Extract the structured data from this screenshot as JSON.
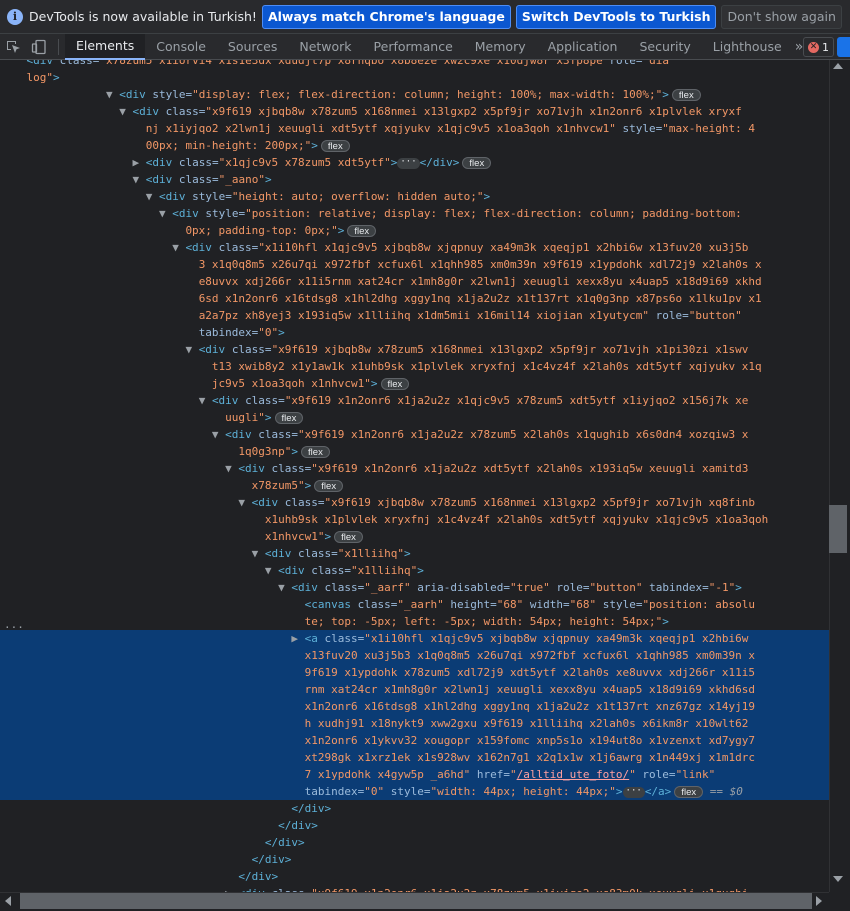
{
  "infobar": {
    "message": "DevTools is now available in Turkish!",
    "btn_match": "Always match Chrome's language",
    "btn_switch": "Switch DevTools to Turkish",
    "btn_dismiss": "Don't show again"
  },
  "toolbar": {
    "tabs": [
      "Elements",
      "Console",
      "Sources",
      "Network",
      "Performance",
      "Memory",
      "Application",
      "Security",
      "Lighthouse"
    ],
    "active_tab": "Elements",
    "more": "»",
    "error_count": "1"
  },
  "tree": {
    "lines": [
      [
        [
          "tx",
          "    "
        ],
        [
          "tag",
          "<div "
        ],
        [
          "an",
          "class="
        ],
        [
          "av",
          "\"x78zum5 x1iorvi4 x1s1e3dx xdudjt7p x8rhqbo x8b8e2e xw2c9xe x10djw8r x3fp8pe"
        ],
        [
          "an",
          " role="
        ],
        [
          "av",
          "\"dia"
        ]
      ],
      [
        [
          "tx",
          "    "
        ],
        [
          "av",
          "log\""
        ],
        [
          "tag",
          ">"
        ]
      ],
      [
        [
          "tx",
          "                "
        ],
        [
          "tri",
          "▼ "
        ],
        [
          "tag",
          "<div "
        ],
        [
          "an",
          "style="
        ],
        [
          "av",
          "\"display: flex; flex-direction: column; height: 100%; max-width: 100%;\""
        ],
        [
          "tag",
          ">"
        ],
        [
          "pill",
          "flex"
        ]
      ],
      [
        [
          "tx",
          "                  "
        ],
        [
          "tri",
          "▼ "
        ],
        [
          "tag",
          "<div "
        ],
        [
          "an",
          "class="
        ],
        [
          "av",
          "\"x9f619 xjbqb8w x78zum5 x168nmei x13lgxp2 x5pf9jr xo71vjh x1n2onr6 x1plvlek xryxf"
        ]
      ],
      [
        [
          "tx",
          "                      "
        ],
        [
          "av",
          "nj x1iyjqo2 x2lwn1j xeuugli xdt5ytf xqjyukv x1qjc9v5 x1oa3qoh x1nhvcw1\""
        ],
        [
          "an",
          " style="
        ],
        [
          "av",
          "\"max-height: 4"
        ]
      ],
      [
        [
          "tx",
          "                      "
        ],
        [
          "av",
          "00px; min-height: 200px;\""
        ],
        [
          "tag",
          ">"
        ],
        [
          "pill",
          "flex"
        ]
      ],
      [
        [
          "tx",
          "                    "
        ],
        [
          "tri",
          "▶ "
        ],
        [
          "tag",
          "<div "
        ],
        [
          "an",
          "class="
        ],
        [
          "av",
          "\"x1qjc9v5 x78zum5 xdt5ytf\""
        ],
        [
          "tag",
          ">"
        ],
        [
          "ell",
          "···"
        ],
        [
          "tag",
          "</div>"
        ],
        [
          "pill",
          "flex"
        ]
      ],
      [
        [
          "tx",
          "                    "
        ],
        [
          "tri",
          "▼ "
        ],
        [
          "tag",
          "<div "
        ],
        [
          "an",
          "class="
        ],
        [
          "av",
          "\"_aano\""
        ],
        [
          "tag",
          ">"
        ]
      ],
      [
        [
          "tx",
          "                      "
        ],
        [
          "tri",
          "▼ "
        ],
        [
          "tag",
          "<div "
        ],
        [
          "an",
          "style="
        ],
        [
          "av",
          "\"height: auto; overflow: hidden auto;\""
        ],
        [
          "tag",
          ">"
        ]
      ],
      [
        [
          "tx",
          "                        "
        ],
        [
          "tri",
          "▼ "
        ],
        [
          "tag",
          "<div "
        ],
        [
          "an",
          "style="
        ],
        [
          "av",
          "\"position: relative; display: flex; flex-direction: column; padding-bottom:"
        ]
      ],
      [
        [
          "tx",
          "                            "
        ],
        [
          "av",
          "0px; padding-top: 0px;\""
        ],
        [
          "tag",
          ">"
        ],
        [
          "pill",
          "flex"
        ]
      ],
      [
        [
          "tx",
          "                          "
        ],
        [
          "tri",
          "▼ "
        ],
        [
          "tag",
          "<div "
        ],
        [
          "an",
          "class="
        ],
        [
          "av",
          "\"x1i10hfl x1qjc9v5 xjbqb8w xjqpnuy xa49m3k xqeqjp1 x2hbi6w x13fuv20 xu3j5b"
        ]
      ],
      [
        [
          "tx",
          "                              "
        ],
        [
          "av",
          "3 x1q0q8m5 x26u7qi x972fbf xcfux6l x1qhh985 xm0m39n x9f619 x1ypdohk xdl72j9 x2lah0s x"
        ]
      ],
      [
        [
          "tx",
          "                              "
        ],
        [
          "av",
          "e8uvvx xdj266r x11i5rnm xat24cr x1mh8g0r x2lwn1j xeuugli xexx8yu x4uap5 x18d9i69 xkhd"
        ]
      ],
      [
        [
          "tx",
          "                              "
        ],
        [
          "av",
          "6sd x1n2onr6 x16tdsg8 x1hl2dhg xggy1nq x1ja2u2z x1t137rt x1q0g3np x87ps6o x1lku1pv x1"
        ]
      ],
      [
        [
          "tx",
          "                              "
        ],
        [
          "av",
          "a2a7pz xh8yej3 x193iq5w x1lliihq x1dm5mii x16mil14 xiojian x1yutycm\""
        ],
        [
          "an",
          " role="
        ],
        [
          "av",
          "\"button\""
        ]
      ],
      [
        [
          "tx",
          "                              "
        ],
        [
          "an",
          "tabindex="
        ],
        [
          "av",
          "\"0\""
        ],
        [
          "tag",
          ">"
        ]
      ],
      [
        [
          "tx",
          "                            "
        ],
        [
          "tri",
          "▼ "
        ],
        [
          "tag",
          "<div "
        ],
        [
          "an",
          "class="
        ],
        [
          "av",
          "\"x9f619 xjbqb8w x78zum5 x168nmei x13lgxp2 x5pf9jr xo71vjh x1pi30zi x1swv"
        ]
      ],
      [
        [
          "tx",
          "                                "
        ],
        [
          "av",
          "t13 xwib8y2 x1y1aw1k x1uhb9sk x1plvlek xryxfnj x1c4vz4f x2lah0s xdt5ytf xqjyukv x1q"
        ]
      ],
      [
        [
          "tx",
          "                                "
        ],
        [
          "av",
          "jc9v5 x1oa3qoh x1nhvcw1\""
        ],
        [
          "tag",
          ">"
        ],
        [
          "pill",
          "flex"
        ]
      ],
      [
        [
          "tx",
          "                              "
        ],
        [
          "tri",
          "▼ "
        ],
        [
          "tag",
          "<div "
        ],
        [
          "an",
          "class="
        ],
        [
          "av",
          "\"x9f619 x1n2onr6 x1ja2u2z x1qjc9v5 x78zum5 xdt5ytf x1iyjqo2 x156j7k xe"
        ]
      ],
      [
        [
          "tx",
          "                                  "
        ],
        [
          "av",
          "uugli\""
        ],
        [
          "tag",
          ">"
        ],
        [
          "pill",
          "flex"
        ]
      ],
      [
        [
          "tx",
          "                                "
        ],
        [
          "tri",
          "▼ "
        ],
        [
          "tag",
          "<div "
        ],
        [
          "an",
          "class="
        ],
        [
          "av",
          "\"x9f619 x1n2onr6 x1ja2u2z x78zum5 x2lah0s x1qughib x6s0dn4 xozqiw3 x"
        ]
      ],
      [
        [
          "tx",
          "                                    "
        ],
        [
          "av",
          "1q0g3np\""
        ],
        [
          "tag",
          ">"
        ],
        [
          "pill",
          "flex"
        ]
      ],
      [
        [
          "tx",
          "                                  "
        ],
        [
          "tri",
          "▼ "
        ],
        [
          "tag",
          "<div "
        ],
        [
          "an",
          "class="
        ],
        [
          "av",
          "\"x9f619 x1n2onr6 x1ja2u2z xdt5ytf x2lah0s x193iq5w xeuugli xamitd3"
        ]
      ],
      [
        [
          "tx",
          "                                      "
        ],
        [
          "av",
          "x78zum5\""
        ],
        [
          "tag",
          ">"
        ],
        [
          "pill",
          "flex"
        ]
      ],
      [
        [
          "tx",
          "                                    "
        ],
        [
          "tri",
          "▼ "
        ],
        [
          "tag",
          "<div "
        ],
        [
          "an",
          "class="
        ],
        [
          "av",
          "\"x9f619 xjbqb8w x78zum5 x168nmei x13lgxp2 x5pf9jr xo71vjh xq8finb"
        ]
      ],
      [
        [
          "tx",
          "                                        "
        ],
        [
          "av",
          "x1uhb9sk x1plvlek xryxfnj x1c4vz4f x2lah0s xdt5ytf xqjyukv x1qjc9v5 x1oa3qoh"
        ]
      ],
      [
        [
          "tx",
          "                                        "
        ],
        [
          "av",
          "x1nhvcw1\""
        ],
        [
          "tag",
          ">"
        ],
        [
          "pill",
          "flex"
        ]
      ],
      [
        [
          "tx",
          "                                      "
        ],
        [
          "tri",
          "▼ "
        ],
        [
          "tag",
          "<div "
        ],
        [
          "an",
          "class="
        ],
        [
          "av",
          "\"x1lliihq\""
        ],
        [
          "tag",
          ">"
        ]
      ],
      [
        [
          "tx",
          "                                        "
        ],
        [
          "tri",
          "▼ "
        ],
        [
          "tag",
          "<div "
        ],
        [
          "an",
          "class="
        ],
        [
          "av",
          "\"x1lliihq\""
        ],
        [
          "tag",
          ">"
        ]
      ],
      [
        [
          "tx",
          "                                          "
        ],
        [
          "tri",
          "▼ "
        ],
        [
          "tag",
          "<div "
        ],
        [
          "an",
          "class="
        ],
        [
          "av",
          "\"_aarf\""
        ],
        [
          "an",
          " aria-disabled="
        ],
        [
          "av",
          "\"true\""
        ],
        [
          "an",
          " role="
        ],
        [
          "av",
          "\"button\""
        ],
        [
          "an",
          " tabindex="
        ],
        [
          "av",
          "\"-1\""
        ],
        [
          "tag",
          ">"
        ]
      ],
      [
        [
          "tx",
          "                                              "
        ],
        [
          "tag",
          "<canvas "
        ],
        [
          "an",
          "class="
        ],
        [
          "av",
          "\"_aarh\""
        ],
        [
          "an",
          " height="
        ],
        [
          "av",
          "\"68\""
        ],
        [
          "an",
          " width="
        ],
        [
          "av",
          "\"68\""
        ],
        [
          "an",
          " style="
        ],
        [
          "av",
          "\"position: absolu"
        ]
      ],
      [
        [
          "tx",
          "                                              "
        ],
        [
          "av",
          "te; top: -5px; left: -5px; width: 54px; height: 54px;\""
        ],
        [
          "tag",
          ">"
        ]
      ],
      [
        [
          "tx",
          "                                            "
        ],
        [
          "tri",
          "▶ "
        ],
        [
          "tag",
          "<a "
        ],
        [
          "an",
          "class="
        ],
        [
          "av",
          "\"x1i10hfl x1qjc9v5 xjbqb8w xjqpnuy xa49m3k xqeqjp1 x2hbi6w"
        ]
      ],
      [
        [
          "tx",
          "                                              "
        ],
        [
          "av",
          "x13fuv20 xu3j5b3 x1q0q8m5 x26u7qi x972fbf xcfux6l x1qhh985 xm0m39n x"
        ]
      ],
      [
        [
          "tx",
          "                                              "
        ],
        [
          "av",
          "9f619 x1ypdohk x78zum5 xdl72j9 xdt5ytf x2lah0s xe8uvvx xdj266r x11i5"
        ]
      ],
      [
        [
          "tx",
          "                                              "
        ],
        [
          "av",
          "rnm xat24cr x1mh8g0r x2lwn1j xeuugli xexx8yu x4uap5 x18d9i69 xkhd6sd"
        ]
      ],
      [
        [
          "tx",
          "                                              "
        ],
        [
          "av",
          "x1n2onr6 x16tdsg8 x1hl2dhg xggy1nq x1ja2u2z x1t137rt xnz67gz x14yj19"
        ]
      ],
      [
        [
          "tx",
          "                                              "
        ],
        [
          "av",
          "h xudhj91 x18nykt9 xww2gxu x9f619 x1lliihq x2lah0s x6ikm8r x10wlt62"
        ]
      ],
      [
        [
          "tx",
          "                                              "
        ],
        [
          "av",
          "x1n2onr6 x1ykvv32 xougopr x159fomc xnp5s1o x194ut8o x1vzenxt xd7ygy7"
        ]
      ],
      [
        [
          "tx",
          "                                              "
        ],
        [
          "av",
          "xt298gk x1xrz1ek x1s928wv x162n7g1 x2q1x1w x1j6awrg x1n449xj x1m1drc"
        ]
      ],
      [
        [
          "tx",
          "                                              "
        ],
        [
          "av",
          "7 x1ypdohk x4gyw5p _a6hd\""
        ],
        [
          "an",
          " href="
        ],
        [
          "av",
          "\""
        ],
        [
          "lk",
          "/alltid_ute_foto/"
        ],
        [
          "av",
          "\""
        ],
        [
          "an",
          " role="
        ],
        [
          "av",
          "\"link\""
        ]
      ],
      [
        [
          "tx",
          "                                              "
        ],
        [
          "an",
          "tabindex="
        ],
        [
          "av",
          "\"0\""
        ],
        [
          "an",
          " style="
        ],
        [
          "av",
          "\"width: 44px; height: 44px;\""
        ],
        [
          "tag",
          ">"
        ],
        [
          "ell",
          "···"
        ],
        [
          "tag",
          "</a>"
        ],
        [
          "pill",
          "flex"
        ],
        [
          "eq0",
          " == $0"
        ]
      ],
      [
        [
          "tx",
          "                                            "
        ],
        [
          "tag",
          "</div>"
        ]
      ],
      [
        [
          "tx",
          "                                          "
        ],
        [
          "tag",
          "</div>"
        ]
      ],
      [
        [
          "tx",
          "                                        "
        ],
        [
          "tag",
          "</div>"
        ]
      ],
      [
        [
          "tx",
          "                                      "
        ],
        [
          "tag",
          "</div>"
        ]
      ],
      [
        [
          "tx",
          "                                    "
        ],
        [
          "tag",
          "</div>"
        ]
      ],
      [
        [
          "tx",
          "                                  "
        ],
        [
          "tri",
          "▶ "
        ],
        [
          "tag",
          "<div "
        ],
        [
          "an",
          "class="
        ],
        [
          "av",
          "\"x9f619 x1n2onr6 x1ja2u2z x78zum5 x1iyjqo2 xs83m0k xeuugli x1qughi"
        ]
      ]
    ],
    "selected_dots": "···"
  }
}
